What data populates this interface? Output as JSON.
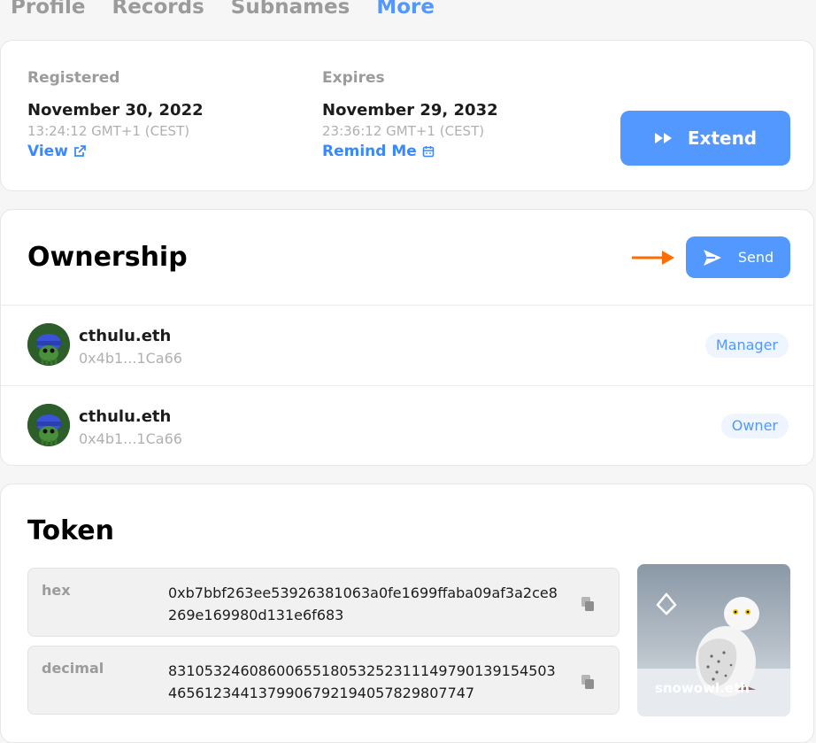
{
  "tabs": [
    {
      "label": "Profile",
      "active": false
    },
    {
      "label": "Records",
      "active": false
    },
    {
      "label": "Subnames",
      "active": false
    },
    {
      "label": "More",
      "active": true
    }
  ],
  "registration": {
    "registered": {
      "label": "Registered",
      "date": "November 30, 2022",
      "time": "13:24:12 GMT+1 (CEST)",
      "link": "View"
    },
    "expires": {
      "label": "Expires",
      "date": "November 29, 2032",
      "time": "23:36:12 GMT+1 (CEST)",
      "link": "Remind Me"
    },
    "extend_label": "Extend"
  },
  "ownership": {
    "title": "Ownership",
    "send_label": "Send",
    "rows": [
      {
        "name": "cthulu.eth",
        "address": "0x4b1...1Ca66",
        "role": "Manager"
      },
      {
        "name": "cthulu.eth",
        "address": "0x4b1...1Ca66",
        "role": "Owner"
      }
    ]
  },
  "token": {
    "title": "Token",
    "hex": {
      "key": "hex",
      "value": "0xb7bbf263ee53926381063a0fe1699ffaba09af3a2ce8269e169980d131e6f683"
    },
    "decimal": {
      "key": "decimal",
      "value": "83105324608600655180532523111497901391545034656123441379906792194057829807747"
    },
    "nft_name": "snowowl.eth"
  },
  "colors": {
    "accent": "#5298ff",
    "arrow": "#ff6d00"
  }
}
